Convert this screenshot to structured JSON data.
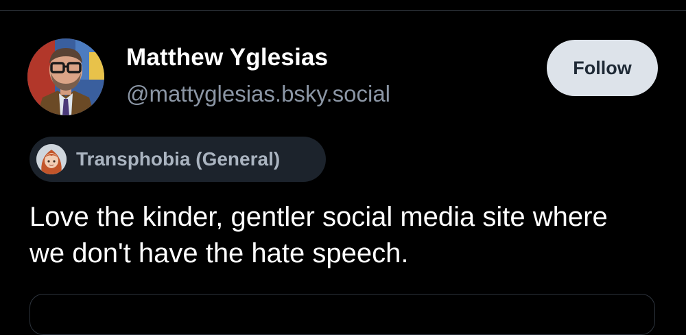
{
  "post": {
    "author": {
      "display_name": "Matthew Yglesias",
      "handle": "@mattyglesias.bsky.social",
      "avatar_icon": "user-avatar-photo"
    },
    "follow_label": "Follow",
    "moderation_label": {
      "text": "Transphobia (General)",
      "avatar_icon": "labeler-avatar"
    },
    "text": "Love the kinder, gentler social media site where we don't have the hate speech."
  },
  "colors": {
    "background": "#000000",
    "handle": "#8b96a5",
    "follow_button_bg": "#dde3ea",
    "label_chip_bg": "#1c232c"
  }
}
